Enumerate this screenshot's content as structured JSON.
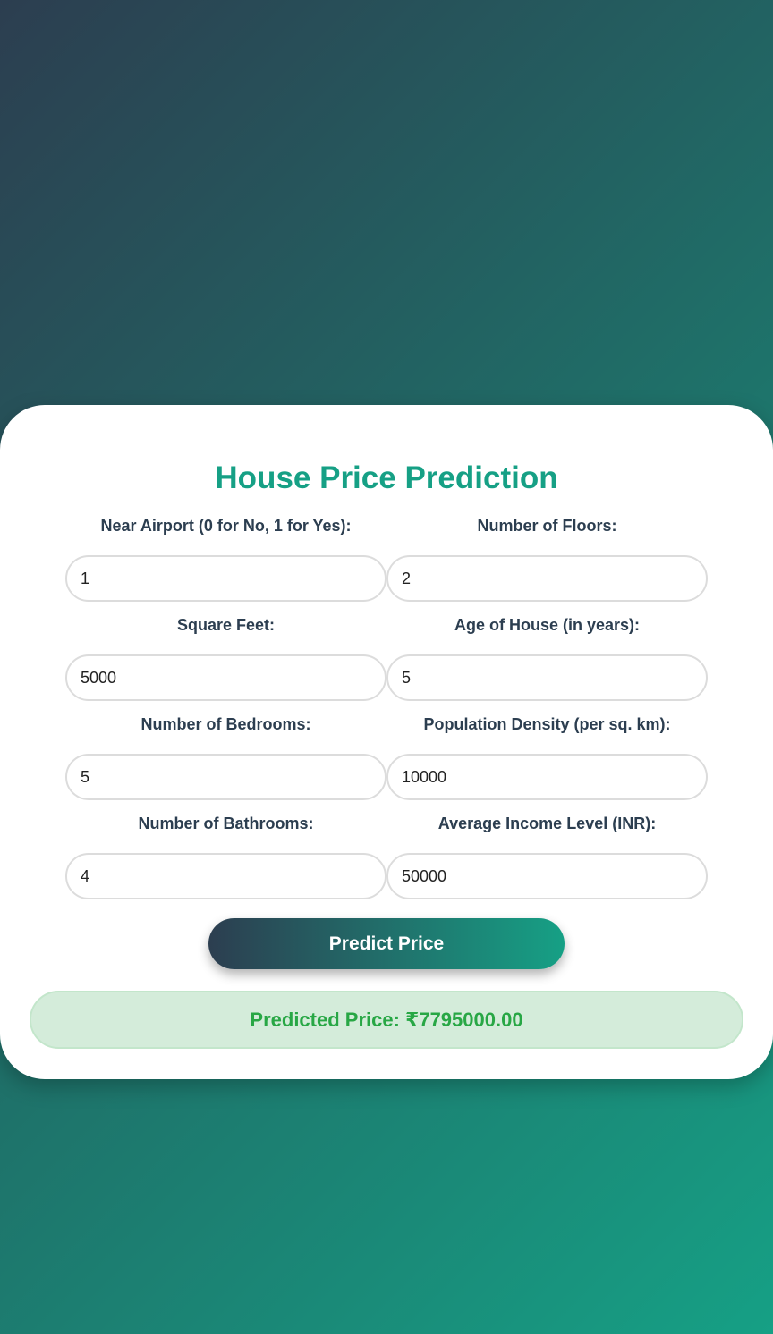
{
  "form": {
    "title": "House Price Prediction",
    "fields": [
      {
        "label": "Near Airport (0 for No, 1 for Yes):",
        "value": "1"
      },
      {
        "label": "Number of Floors:",
        "value": "2"
      },
      {
        "label": "Square Feet:",
        "value": "5000"
      },
      {
        "label": "Age of House (in years):",
        "value": "5"
      },
      {
        "label": "Number of Bedrooms:",
        "value": "5"
      },
      {
        "label": "Population Density (per sq. km):",
        "value": "10000"
      },
      {
        "label": "Number of Bathrooms:",
        "value": "4"
      },
      {
        "label": "Average Income Level (INR):",
        "value": "50000"
      }
    ],
    "submit_label": "Predict Price",
    "result_text": "Predicted Price: ₹7795000.00"
  },
  "colors": {
    "accent": "#16a085",
    "dark": "#2c3e50",
    "success_text": "#28a745",
    "success_bg": "#d4ecda"
  }
}
